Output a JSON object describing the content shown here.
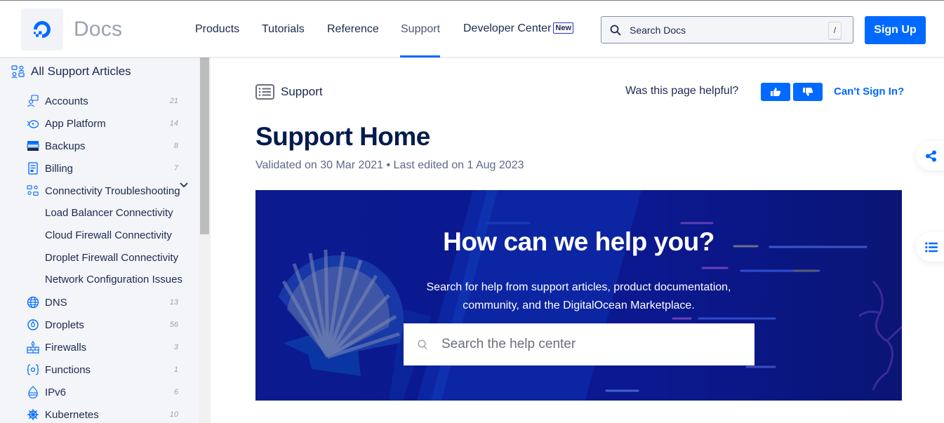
{
  "header": {
    "logo_text": "Docs",
    "nav": [
      {
        "label": "Products"
      },
      {
        "label": "Tutorials"
      },
      {
        "label": "Reference"
      },
      {
        "label": "Support",
        "active": true
      },
      {
        "label": "Developer Center",
        "badge": "New"
      }
    ],
    "search_placeholder": "Search Docs",
    "search_shortcut": "/",
    "signup_label": "Sign Up"
  },
  "sidebar": {
    "all_label": "All Support Articles",
    "items": [
      {
        "label": "Accounts",
        "count": "21",
        "icon": "accounts-icon"
      },
      {
        "label": "App Platform",
        "count": "14",
        "icon": "app-platform-icon"
      },
      {
        "label": "Backups",
        "count": "8",
        "icon": "backups-icon"
      },
      {
        "label": "Billing",
        "count": "7",
        "icon": "billing-icon"
      },
      {
        "label": "Connectivity Troubleshooting",
        "count": "",
        "icon": "connectivity-icon",
        "expanded": true
      }
    ],
    "subitems": [
      {
        "label": "Load Balancer Connectivity"
      },
      {
        "label": "Cloud Firewall Connectivity"
      },
      {
        "label": "Droplet Firewall Connectivity"
      },
      {
        "label": "Network Configuration Issues"
      }
    ],
    "items_after": [
      {
        "label": "DNS",
        "count": "13",
        "icon": "dns-globe-icon"
      },
      {
        "label": "Droplets",
        "count": "56",
        "icon": "droplet-icon"
      },
      {
        "label": "Firewalls",
        "count": "3",
        "icon": "firewall-icon"
      },
      {
        "label": "Functions",
        "count": "1",
        "icon": "functions-icon"
      },
      {
        "label": "IPv6",
        "count": "6",
        "icon": "ipv6-icon"
      },
      {
        "label": "Kubernetes",
        "count": "10",
        "icon": "kubernetes-icon"
      }
    ]
  },
  "main": {
    "breadcrumb": "Support",
    "helpful_question": "Was this page helpful?",
    "cant_sign_in": "Can't Sign In?",
    "title": "Support Home",
    "meta": "Validated on 30 Mar 2021 • Last edited on 1 Aug 2023",
    "hero": {
      "heading": "How can we help you?",
      "line1": "Search for help from support articles, product documentation,",
      "line2": "community, and the DigitalOcean Marketplace.",
      "search_placeholder": "Search the help center"
    }
  },
  "colors": {
    "brand_blue": "#0069ff",
    "hero_bg": "#0a1a8c",
    "title": "#031b4e"
  }
}
